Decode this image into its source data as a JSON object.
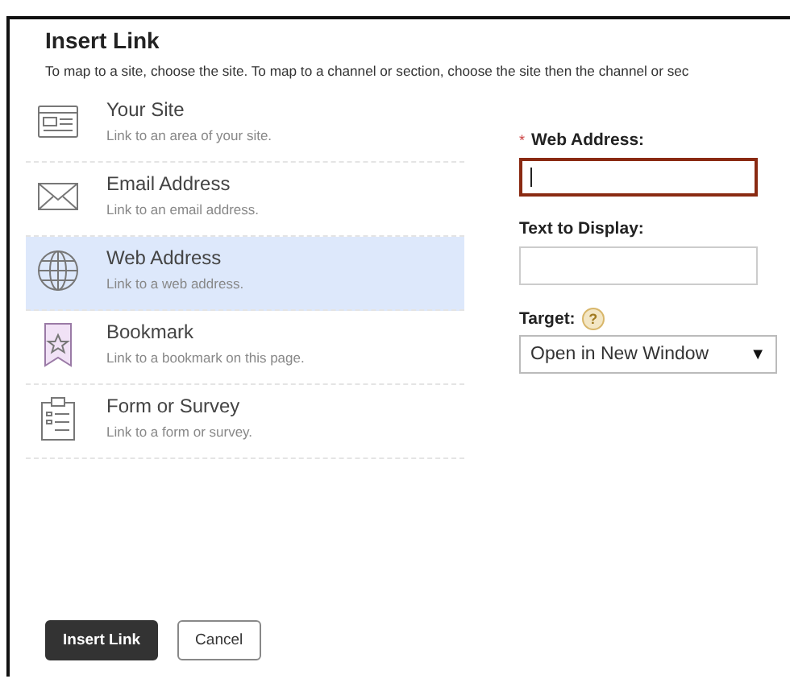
{
  "dialog": {
    "title": "Insert Link",
    "description": "To map to a site, choose the site. To map to a channel or section, choose the site then the channel or sec"
  },
  "link_types": [
    {
      "kind": "site",
      "name": "Your Site",
      "hint": "Link to an area of your site.",
      "selected": false
    },
    {
      "kind": "email",
      "name": "Email Address",
      "hint": "Link to an email address.",
      "selected": false
    },
    {
      "kind": "web",
      "name": "Web Address",
      "hint": "Link to a web address.",
      "selected": true
    },
    {
      "kind": "bookmark",
      "name": "Bookmark",
      "hint": "Link to a bookmark on this page.",
      "selected": false
    },
    {
      "kind": "form",
      "name": "Form or Survey",
      "hint": "Link to a form or survey.",
      "selected": false
    }
  ],
  "form": {
    "web_address": {
      "required_mark": "*",
      "label": "Web Address:",
      "focused": true
    },
    "text_to_display": {
      "label": "Text to Display:",
      "focused": false
    },
    "target": {
      "label": "Target:",
      "help": "?",
      "value": "Open in New Window",
      "arrow": "▼"
    }
  },
  "buttons": [
    {
      "kind": "primary",
      "label": "Insert Link"
    },
    {
      "kind": "secondary",
      "label": "Cancel"
    }
  ]
}
